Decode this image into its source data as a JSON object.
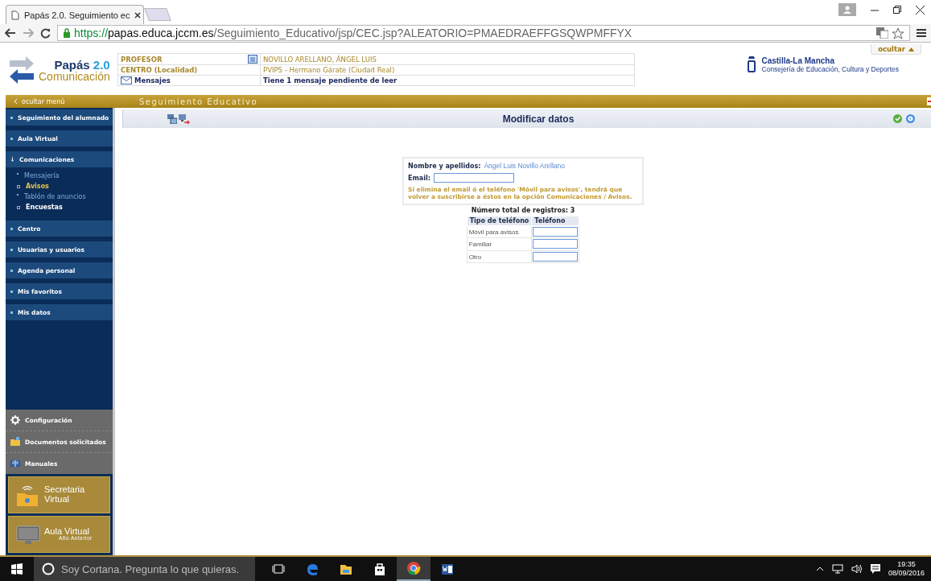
{
  "browser": {
    "tab_title": "Papás 2.0. Seguimiento ec",
    "url_scheme": "https://",
    "url_host": "papas.educa.jccm.es",
    "url_path": "/Seguimiento_Educativo/jsp/CEC.jsp?ALEATORIO=PMAEDRAEFFGSQWPMFFYX"
  },
  "header": {
    "logo": {
      "title": "Papás",
      "version": "2.0",
      "subtitle": "Comunicación"
    },
    "info": [
      {
        "kind": "profile",
        "label": "PROFESOR",
        "value": "NOVILLO ARELLANO, ÁNGEL LUIS"
      },
      {
        "kind": "plain",
        "label": "CENTRO (Localidad)",
        "value": "PVIPS - Hermano Gárate (Ciudad Real)"
      },
      {
        "kind": "messages",
        "label": "Mensajes",
        "value": "Tiene 1 mensaje pendiente de leer"
      }
    ],
    "org": {
      "name": "Castilla-La Mancha",
      "department": "Consejería de Educación, Cultura y Deportes"
    },
    "hide_button": "ocultar"
  },
  "bar": {
    "hide_menu": "ocultar menú",
    "title": "Seguimiento Educativo"
  },
  "menu": [
    {
      "label": "Seguimiento del alumnado",
      "expanded": false
    },
    {
      "label": "Aula Virtual",
      "expanded": false
    },
    {
      "label": "Comunicaciones",
      "expanded": true,
      "children": [
        {
          "label": "Mensajería",
          "kind": "link",
          "selected": false
        },
        {
          "label": "Avisos",
          "kind": "page",
          "selected": true
        },
        {
          "label": "Tablón de anuncios",
          "kind": "link",
          "selected": false
        },
        {
          "label": "Encuestas",
          "kind": "page",
          "selected": false
        }
      ]
    },
    {
      "label": "Centro",
      "expanded": false
    },
    {
      "label": "Usuarias y usuarios",
      "expanded": false
    },
    {
      "label": "Agenda personal",
      "expanded": false
    },
    {
      "label": "Mis favoritos",
      "expanded": false
    },
    {
      "label": "Mis datos",
      "expanded": false
    }
  ],
  "tools": [
    {
      "kind": "gear",
      "label": "Configuración"
    },
    {
      "kind": "folder",
      "label": "Documentos solicitados"
    },
    {
      "kind": "book",
      "label": "Manuales"
    }
  ],
  "banners": [
    {
      "kind": "folder",
      "title": "Secretaria Virtual"
    },
    {
      "kind": "monitor",
      "title": "Aula Virtual",
      "subtitle": "Año Anterior"
    }
  ],
  "content": {
    "title": "Modificar datos",
    "name_label": "Nombre y apellidos:",
    "name_value": "Ángel Luis Novillo Arellano",
    "email_label": "Email:",
    "warning": "Si elimina el email ó el teléfono 'Móvil para avisos', tendrá que volver a suscribirse a éstos en la opción Comunicaciones / Avisos.",
    "record_count": "Número total de registros: 3",
    "columns": [
      "Tipo de teléfono",
      "Teléfono"
    ],
    "rows": [
      {
        "type": "Móvil para avisos"
      },
      {
        "type": "Familiar"
      },
      {
        "type": "Otro"
      }
    ]
  },
  "taskbar": {
    "search_placeholder": "Soy Cortana. Pregunta lo que quieras.",
    "apps": [
      {
        "kind": "taskview",
        "selected": false
      },
      {
        "kind": "edge",
        "selected": false
      },
      {
        "kind": "explorer",
        "selected": false
      },
      {
        "kind": "store",
        "selected": false
      },
      {
        "kind": "chrome",
        "selected": true
      },
      {
        "kind": "word",
        "selected": false
      }
    ],
    "time": "19:35",
    "date": "08/09/2016"
  }
}
